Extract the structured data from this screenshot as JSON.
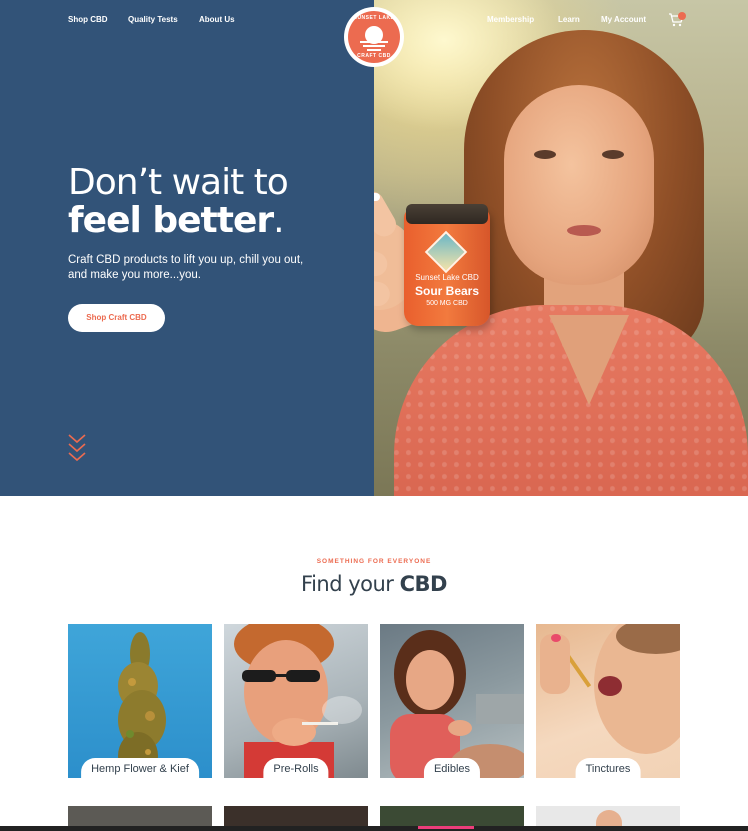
{
  "nav": {
    "left": [
      "Shop CBD",
      "Quality Tests",
      "About Us"
    ],
    "right": [
      "Membership",
      "Learn",
      "My Account"
    ],
    "cart_icon": "cart-icon",
    "logo": {
      "top": "SUNSET LAKE",
      "bottom": "CRAFT CBD"
    }
  },
  "hero": {
    "headline_light": "Don’t wait to",
    "headline_bold": "feel better",
    "headline_period": ".",
    "subheadline": "Craft CBD products to lift you up, chill you out, and make you more...you.",
    "cta": "Shop Craft CBD",
    "product": {
      "line1": "Sunset Lake CBD",
      "line2": "Sour Bears",
      "line3": "500 MG CBD"
    },
    "scroll_icon": "chevrons-down-icon"
  },
  "section": {
    "eyebrow": "SOMETHING FOR EVERYONE",
    "title_light": "Find your ",
    "title_bold": "CBD"
  },
  "categories": [
    {
      "label": "Hemp Flower & Kief"
    },
    {
      "label": "Pre-Rolls"
    },
    {
      "label": "Edibles"
    },
    {
      "label": "Tinctures"
    }
  ],
  "colors": {
    "hero_blue": "#325378",
    "accent": "#ec6b50",
    "text_dark": "#33414d"
  }
}
